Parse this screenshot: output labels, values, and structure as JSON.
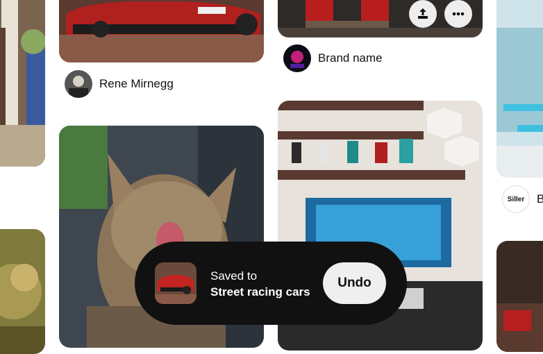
{
  "pins": {
    "car_pin_creator": "Rene Mirnegg",
    "figurine_pin_creator": "Brand name",
    "right_pin_creator": "Be",
    "right_pin_avatar_text": "Siller"
  },
  "toast": {
    "line1": "Saved to",
    "board_name": "Street racing cars",
    "undo_label": "Undo"
  },
  "icons": [
    "share-icon",
    "more-options-icon"
  ],
  "colors": {
    "toast_bg": "#111111",
    "undo_bg": "#efefef",
    "page_bg": "#ffffff"
  }
}
